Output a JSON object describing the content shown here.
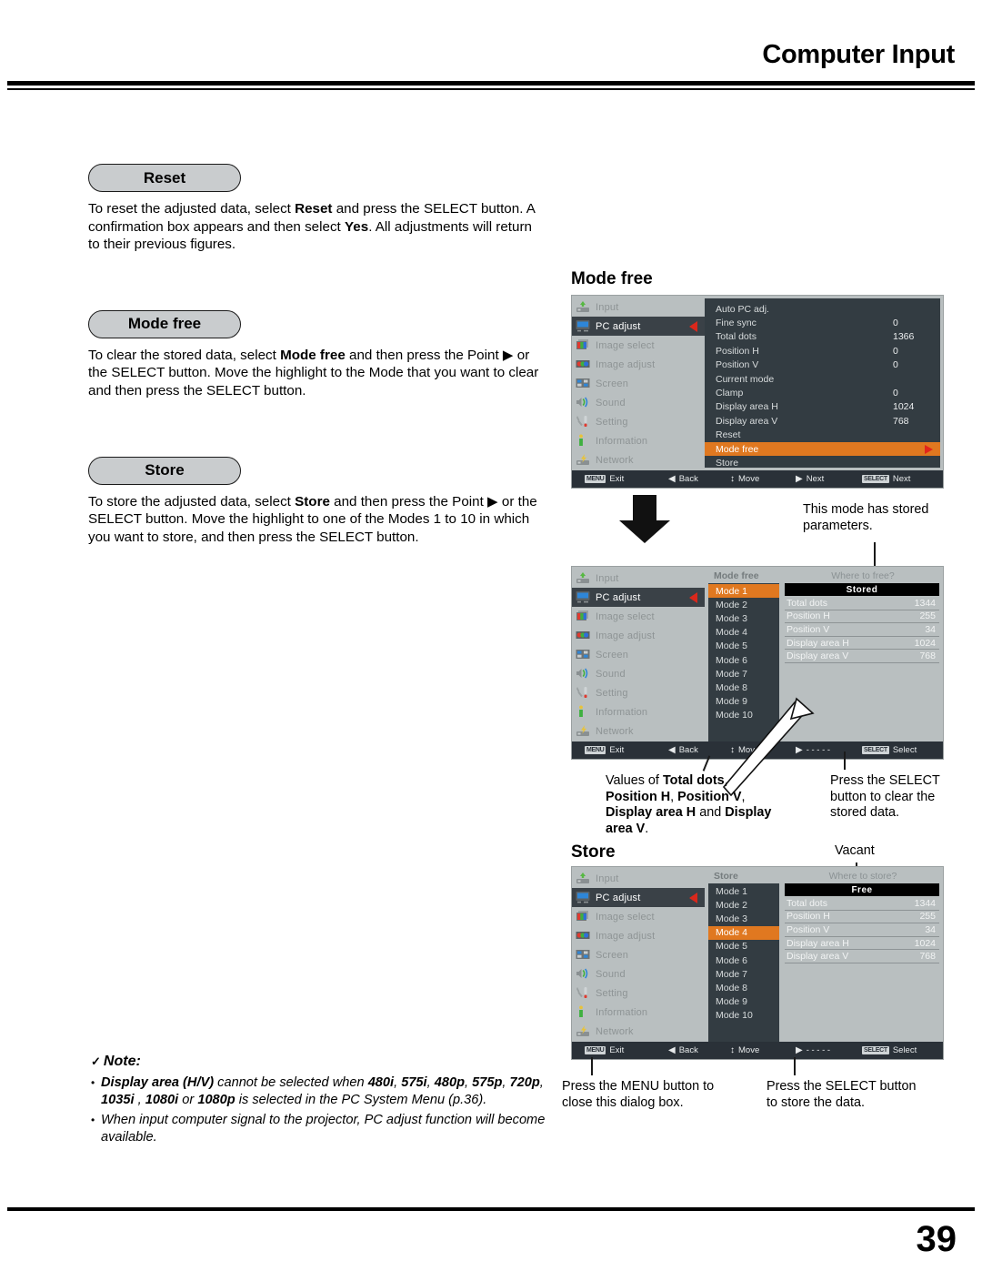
{
  "header": {
    "title": "Computer Input"
  },
  "footer": {
    "page_number": "39"
  },
  "sections": {
    "reset": {
      "pill_label": "Reset",
      "body_html": "To reset the adjusted data, select <b>Reset</b> and press the SELECT button. A confirmation box appears and then select <b>Yes</b>. All adjustments will return to their previous figures."
    },
    "mode_free": {
      "pill_label": "Mode free",
      "body_html": "To clear the stored data, select <b>Mode free</b> and then press the Point ▶ or the SELECT button. Move the highlight to the Mode that you want to clear and then press the SELECT button."
    },
    "store": {
      "pill_label": "Store",
      "body_html": "To store the adjusted data, select <b>Store</b> and then press the Point ▶ or the SELECT button. Move the highlight to one of the Modes 1 to 10 in which you want to store, and then press the SELECT button."
    }
  },
  "note": {
    "check": "✓",
    "title": "Note:",
    "items_html": [
      "<b>Display area (H/V)</b> cannot be selected when <b>480i</b>, <b>575i</b>, <b>480p</b>, <b>575p</b>, <b>720p</b>, <b>1035i</b> , <b>1080i</b> or <b>1080p</b> is selected in the PC System Menu (p.36).",
      "When input computer signal to the projector, PC adjust function will become available."
    ]
  },
  "sidebar": {
    "items": [
      {
        "label": "Input",
        "icon": "input-icon"
      },
      {
        "label": "PC adjust",
        "icon": "monitor-icon"
      },
      {
        "label": "Image select",
        "icon": "image-select-icon"
      },
      {
        "label": "Image adjust",
        "icon": "image-adjust-icon"
      },
      {
        "label": "Screen",
        "icon": "screen-icon"
      },
      {
        "label": "Sound",
        "icon": "speaker-icon"
      },
      {
        "label": "Setting",
        "icon": "wrench-icon"
      },
      {
        "label": "Information",
        "icon": "info-icon"
      },
      {
        "label": "Network",
        "icon": "network-icon"
      }
    ],
    "active_index": 1
  },
  "osd_mode_free": {
    "caption": "Mode free",
    "menu_rows": [
      {
        "label": "Auto PC adj.",
        "value": ""
      },
      {
        "label": "Fine sync",
        "value": "0"
      },
      {
        "label": "Total dots",
        "value": "1366"
      },
      {
        "label": "Position H",
        "value": "0"
      },
      {
        "label": "Position V",
        "value": "0"
      },
      {
        "label": "Current mode",
        "value": ""
      },
      {
        "label": "Clamp",
        "value": "0"
      },
      {
        "label": "Display area H",
        "value": "1024"
      },
      {
        "label": "Display area V",
        "value": "768"
      },
      {
        "label": "Reset",
        "value": ""
      },
      {
        "label": "Mode free",
        "value": "",
        "highlighted": true
      },
      {
        "label": "Store",
        "value": ""
      }
    ],
    "status": [
      {
        "key": "MENU",
        "sym": "",
        "label": "Exit"
      },
      {
        "key": "",
        "sym": "◀",
        "label": "Back"
      },
      {
        "key": "",
        "sym": "↕",
        "label": "Move"
      },
      {
        "key": "",
        "sym": "▶",
        "label": "Next"
      },
      {
        "key": "SELECT",
        "sym": "",
        "label": "Next"
      }
    ]
  },
  "osd_mode_free_dialog": {
    "list_title": "Mode free",
    "param_title": "Where to free?",
    "banner": "Stored",
    "modes": [
      "Mode 1",
      "Mode 2",
      "Mode 3",
      "Mode 4",
      "Mode 5",
      "Mode 6",
      "Mode 7",
      "Mode 8",
      "Mode 9",
      "Mode 10"
    ],
    "selected_mode_index": 0,
    "params": [
      {
        "label": "Total dots",
        "value": "1344"
      },
      {
        "label": "Position H",
        "value": "255"
      },
      {
        "label": "Position V",
        "value": "34"
      },
      {
        "label": "Display area H",
        "value": "1024"
      },
      {
        "label": "Display area V",
        "value": "768"
      }
    ],
    "status": [
      {
        "key": "MENU",
        "sym": "",
        "label": "Exit"
      },
      {
        "key": "",
        "sym": "◀",
        "label": "Back"
      },
      {
        "key": "",
        "sym": "↕",
        "label": "Move"
      },
      {
        "key": "",
        "sym": "▶",
        "label": "- - - - -"
      },
      {
        "key": "SELECT",
        "sym": "",
        "label": "Select"
      }
    ]
  },
  "osd_store_dialog": {
    "caption": "Store",
    "list_title": "Store",
    "param_title": "Where to store?",
    "banner": "Free",
    "modes": [
      "Mode 1",
      "Mode 2",
      "Mode 3",
      "Mode 4",
      "Mode 5",
      "Mode 6",
      "Mode 7",
      "Mode 8",
      "Mode 9",
      "Mode 10"
    ],
    "selected_mode_index": 3,
    "params": [
      {
        "label": "Total dots",
        "value": "1344"
      },
      {
        "label": "Position H",
        "value": "255"
      },
      {
        "label": "Position V",
        "value": "34"
      },
      {
        "label": "Display area H",
        "value": "1024"
      },
      {
        "label": "Display area V",
        "value": "768"
      }
    ],
    "status": [
      {
        "key": "MENU",
        "sym": "",
        "label": "Exit"
      },
      {
        "key": "",
        "sym": "◀",
        "label": "Back"
      },
      {
        "key": "",
        "sym": "↕",
        "label": "Move"
      },
      {
        "key": "",
        "sym": "▶",
        "label": "- - - - -"
      },
      {
        "key": "SELECT",
        "sym": "",
        "label": "Select"
      }
    ]
  },
  "annotations": {
    "stored_params": "This mode has stored parameters.",
    "values_of_html": "Values of <b>Total dots</b>, <b>Position H</b>, <b>Position V</b>, <b>Display area H</b> and <b>Display area V</b>.",
    "press_select_clear": "Press the SELECT button to clear the stored data.",
    "vacant": "Vacant",
    "press_menu_close": "Press the MENU button to close this dialog box.",
    "press_select_store": "Press the SELECT button to store the data."
  }
}
